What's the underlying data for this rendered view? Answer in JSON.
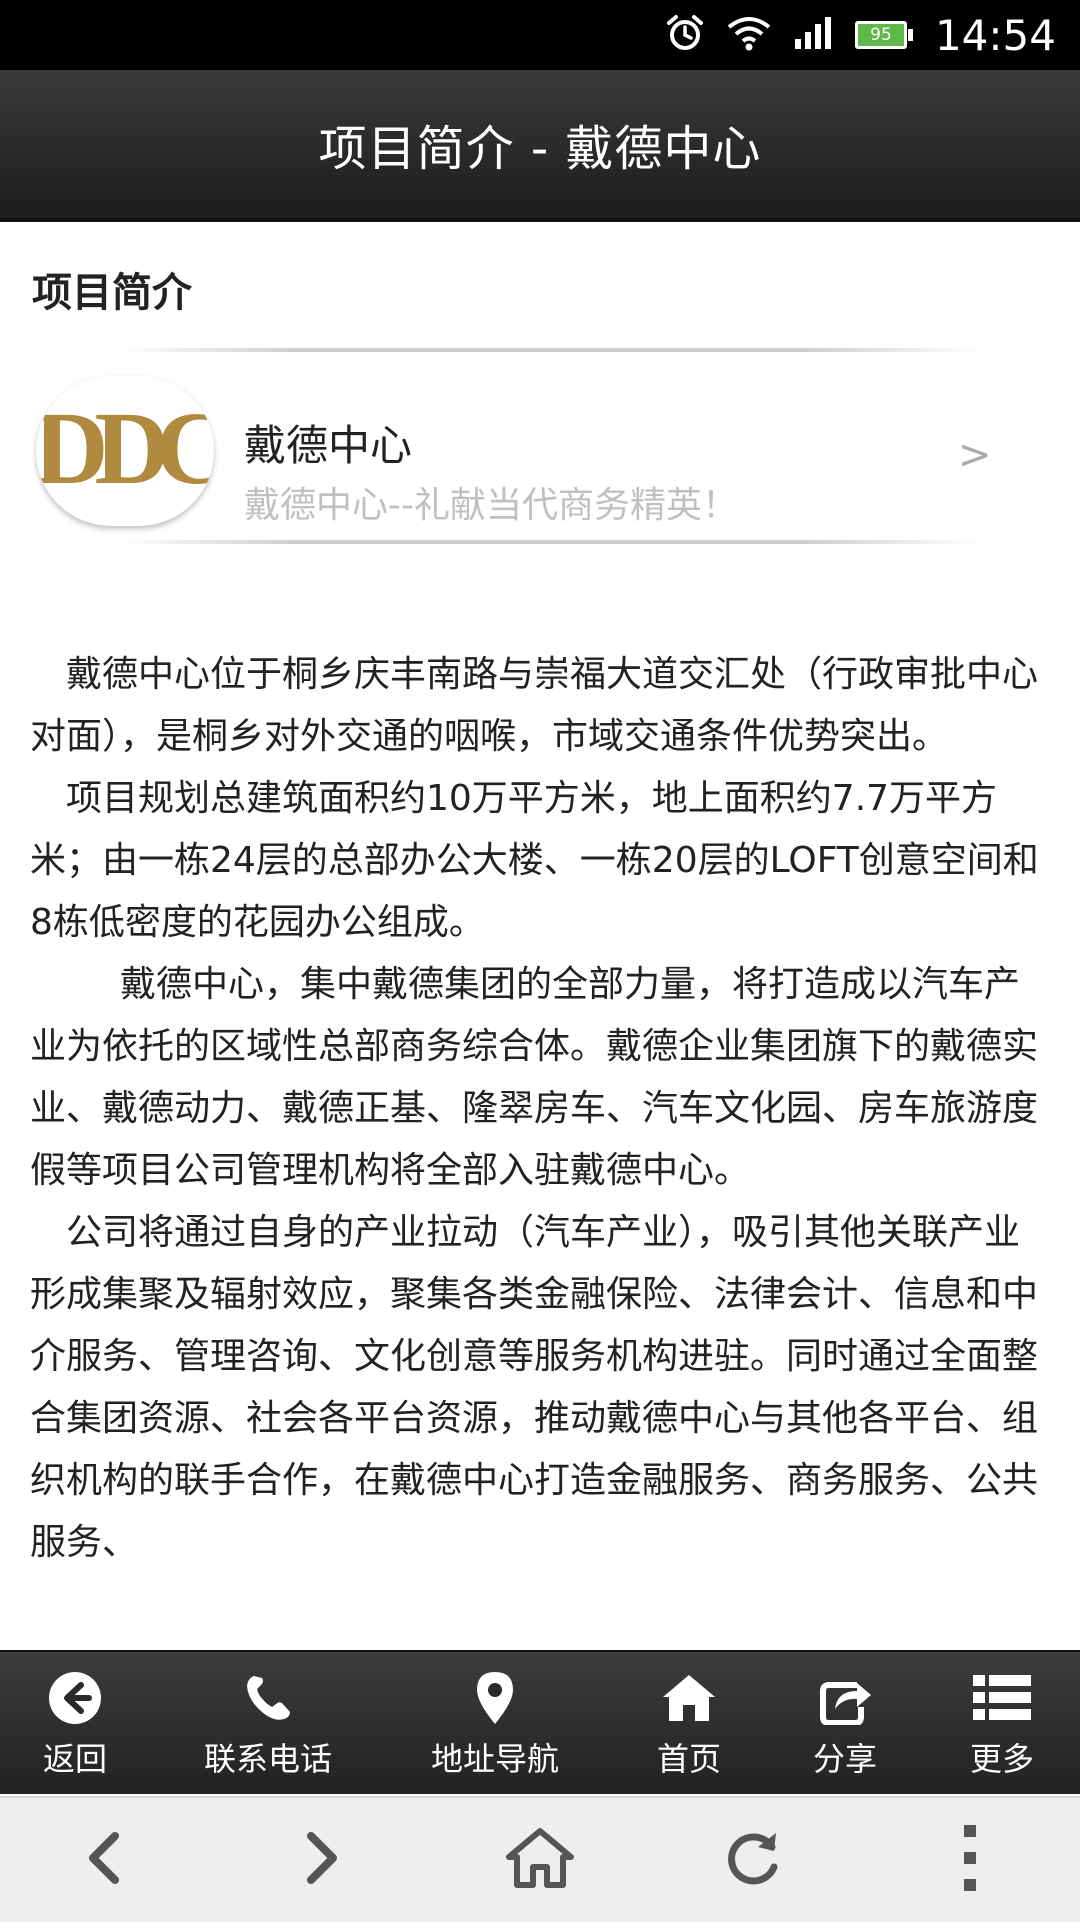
{
  "status_bar": {
    "time": "14:54",
    "battery_level": "95",
    "icons": [
      "alarm-icon",
      "wifi-icon",
      "signal-icon",
      "battery-icon"
    ]
  },
  "app_bar": {
    "title": "项目简介 - 戴德中心"
  },
  "section": {
    "title": "项目简介"
  },
  "project": {
    "logo_text": "DDC",
    "name": "戴德中心",
    "description": "戴德中心--礼献当代商务精英！",
    "chevron": ">"
  },
  "article": {
    "paragraphs": [
      "戴德中心位于桐乡庆丰南路与崇福大道交汇处（行政审批中心对面），是桐乡对外交通的咽喉，市域交通条件优势突出。",
      "项目规划总建筑面积约10万平方米，地上面积约7.7万平方米；由一栋24层的总部办公大楼、一栋20层的LOFT创意空间和8栋低密度的花园办公组成。",
      "戴德中心，集中戴德集团的全部力量，将打造成以汽车产业为依托的区域性总部商务综合体。戴德企业集团旗下的戴德实业、戴德动力、戴德正基、隆翠房车、汽车文化园、房车旅游度假等项目公司管理机构将全部入驻戴德中心。",
      "公司将通过自身的产业拉动（汽车产业），吸引其他关联产业形成集聚及辐射效应，聚集各类金融保险、法律会计、信息和中介服务、管理咨询、文化创意等服务机构进驻。同时通过全面整合集团资源、社会各平台资源，推动戴德中心与其他各平台、组织机构的联手合作，在戴德中心打造金融服务、商务服务、公共服务、"
    ]
  },
  "toolbar": {
    "items": [
      {
        "label": "返回",
        "icon": "back-circle-icon"
      },
      {
        "label": "联系电话",
        "icon": "phone-icon"
      },
      {
        "label": "地址导航",
        "icon": "map-pin-icon"
      },
      {
        "label": "首页",
        "icon": "home-icon"
      },
      {
        "label": "分享",
        "icon": "share-icon"
      },
      {
        "label": "更多",
        "icon": "list-icon"
      }
    ]
  },
  "browser_bar": {
    "buttons": [
      "back-chevron-icon",
      "forward-chevron-icon",
      "home-icon",
      "refresh-icon",
      "overflow-menu-icon"
    ]
  },
  "colors": {
    "status_bar": "#000000",
    "app_bar": "#2a2a2a",
    "toolbar": "#2e2e2e",
    "browser_bar": "#eeeeee",
    "logo_gold": "#b08a3e",
    "description_text": "#c0c0c0"
  }
}
